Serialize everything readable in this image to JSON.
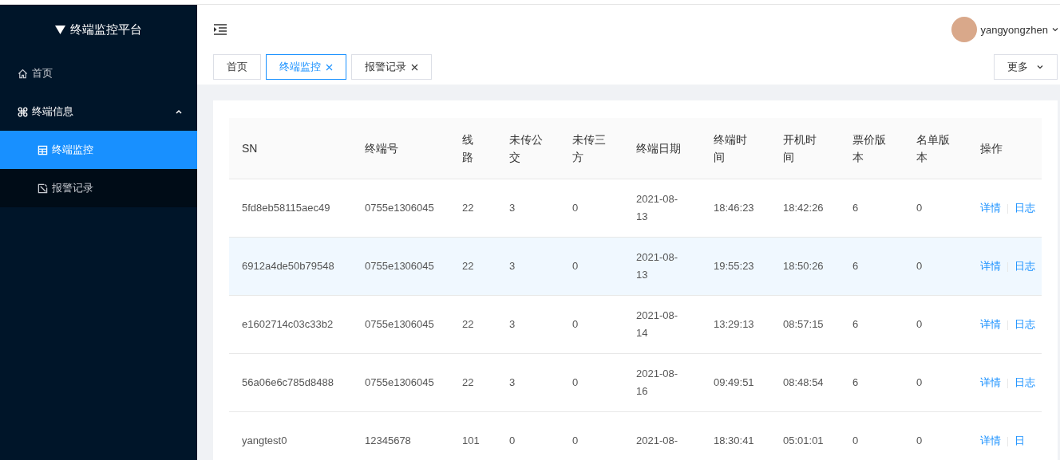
{
  "sidebar": {
    "title": "终端监控平台",
    "menu": [
      {
        "label": "首页",
        "selected": false
      },
      {
        "label": "终端信息",
        "expanded": true,
        "children": [
          {
            "label": "终端监控",
            "selected": true
          },
          {
            "label": "报警记录",
            "selected": false
          }
        ]
      }
    ]
  },
  "header": {
    "user": {
      "name": "yangyongzhen"
    }
  },
  "tabs": [
    {
      "label": "首页",
      "selected": false,
      "closable": false
    },
    {
      "label": "终端监控",
      "selected": true,
      "closable": true
    },
    {
      "label": "报警记录",
      "selected": false,
      "closable": true
    }
  ],
  "more_button": "更多",
  "table": {
    "columns": [
      "SN",
      "终端号",
      "线路",
      "未传公交",
      "未传三方",
      "终端日期",
      "终端时间",
      "开机时间",
      "票价版本",
      "名单版本",
      "操作"
    ],
    "rows": [
      {
        "highlighted": false,
        "cells": [
          "5fd8eb58115aec49",
          "0755e1306045",
          "22",
          "3",
          "0",
          "2021-08-13",
          "18:46:23",
          "18:42:26",
          "6",
          "0"
        ],
        "actions": [
          "详情",
          "日志"
        ]
      },
      {
        "highlighted": true,
        "cells": [
          "6912a4de50b79548",
          "0755e1306045",
          "22",
          "3",
          "0",
          "2021-08-13",
          "19:55:23",
          "18:50:26",
          "6",
          "0"
        ],
        "actions": [
          "详情",
          "日志"
        ]
      },
      {
        "highlighted": false,
        "cells": [
          "e1602714c03c33b2",
          "0755e1306045",
          "22",
          "3",
          "0",
          "2021-08-14",
          "13:29:13",
          "08:57:15",
          "6",
          "0"
        ],
        "actions": [
          "详情",
          "日志"
        ]
      },
      {
        "highlighted": false,
        "cells": [
          "56a06e6c785d8488",
          "0755e1306045",
          "22",
          "3",
          "0",
          "2021-08-16",
          "09:49:51",
          "08:48:54",
          "6",
          "0"
        ],
        "actions": [
          "详情",
          "日志"
        ]
      },
      {
        "highlighted": false,
        "cells": [
          "yangtest0",
          "12345678",
          "101",
          "0",
          "0",
          "2021-08-",
          "18:30:41",
          "05:01:01",
          "0",
          "0"
        ],
        "actions": [
          "详情",
          "日"
        ]
      }
    ]
  }
}
